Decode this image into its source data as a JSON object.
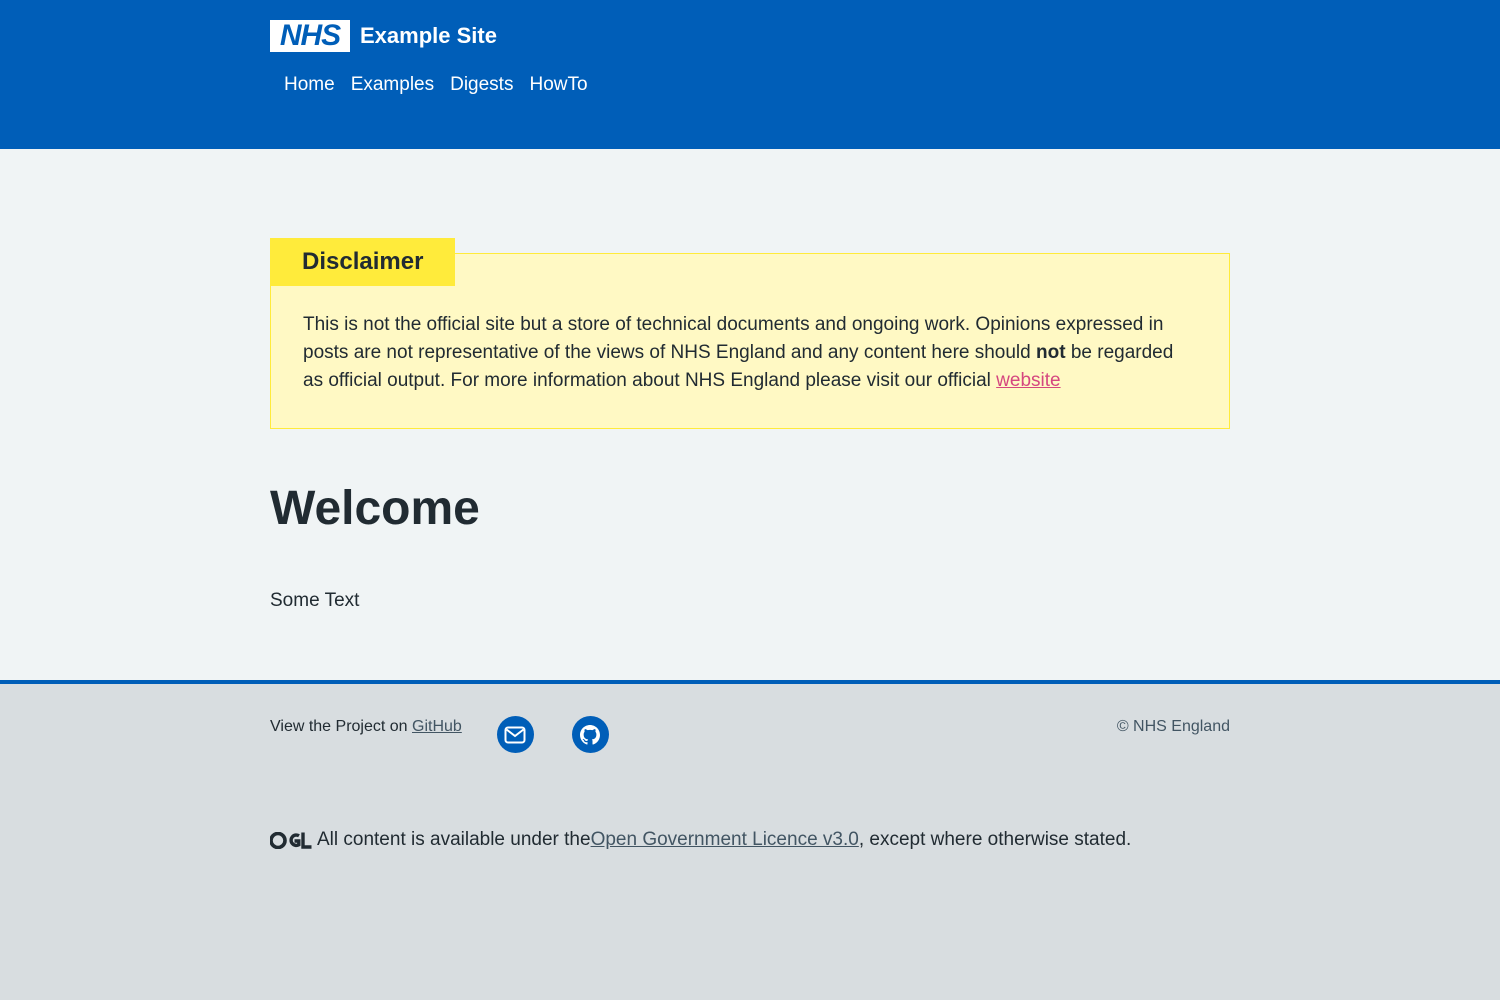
{
  "header": {
    "logo_text": "NHS",
    "site_title": "Example Site",
    "nav": [
      {
        "label": "Home"
      },
      {
        "label": "Examples"
      },
      {
        "label": "Digests"
      },
      {
        "label": "HowTo"
      }
    ]
  },
  "disclaimer": {
    "label": "Disclaimer",
    "text_part1": "This is not the official site but a store of technical documents and ongoing work. Opinions expressed in posts are not representative of the views of NHS England and any content here should ",
    "text_bold": "not",
    "text_part2": " be regarded as official output. For more information about NHS England please visit our official ",
    "link_text": "website"
  },
  "main": {
    "heading": "Welcome",
    "body_text": "Some Text"
  },
  "footer": {
    "view_prefix": "View the Project on ",
    "github_link": "GitHub",
    "copyright": "© NHS England",
    "licence_prefix": "All content is available under the ",
    "licence_link": "Open Government Licence v3.0",
    "licence_suffix": ", except where otherwise stated."
  },
  "icons": {
    "mail": "mail-icon",
    "github": "github-icon",
    "ogl": "ogl-logo"
  },
  "colors": {
    "nhs_blue": "#005eb8",
    "disclaimer_yellow": "#ffeb3b",
    "disclaimer_bg": "#fff9c4",
    "link_pink": "#d5477f"
  }
}
